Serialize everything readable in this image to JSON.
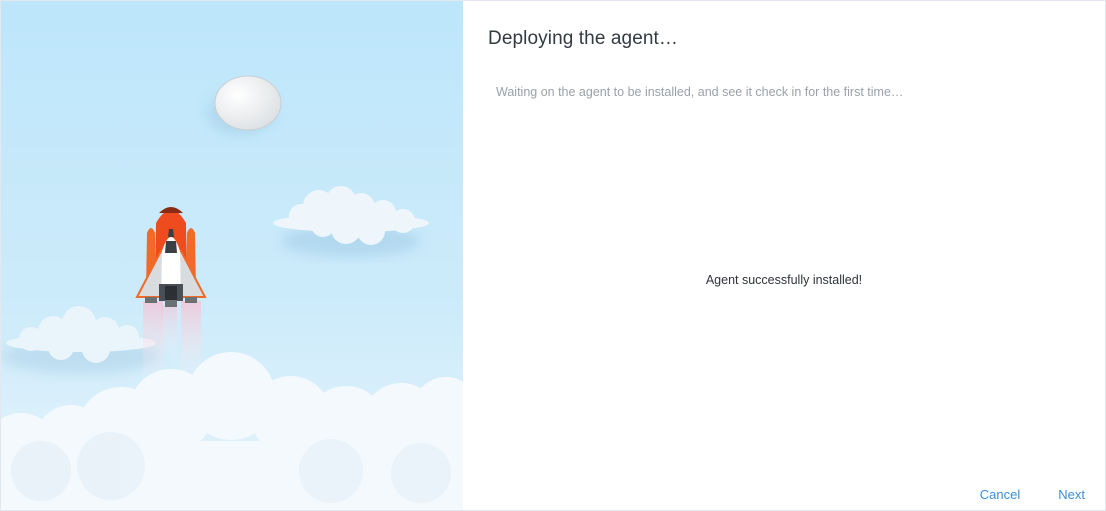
{
  "wizard": {
    "title": "Deploying the agent…",
    "subtitle": "Waiting on the agent to be installed, and see it check in for the first time…",
    "status": "Agent successfully installed!",
    "cancel_label": "Cancel",
    "next_label": "Next"
  },
  "illustration": {
    "sky_color": "#bfe7fb",
    "rocket_color": "#ee4b1e",
    "moon_color": "#f2f2f2"
  }
}
